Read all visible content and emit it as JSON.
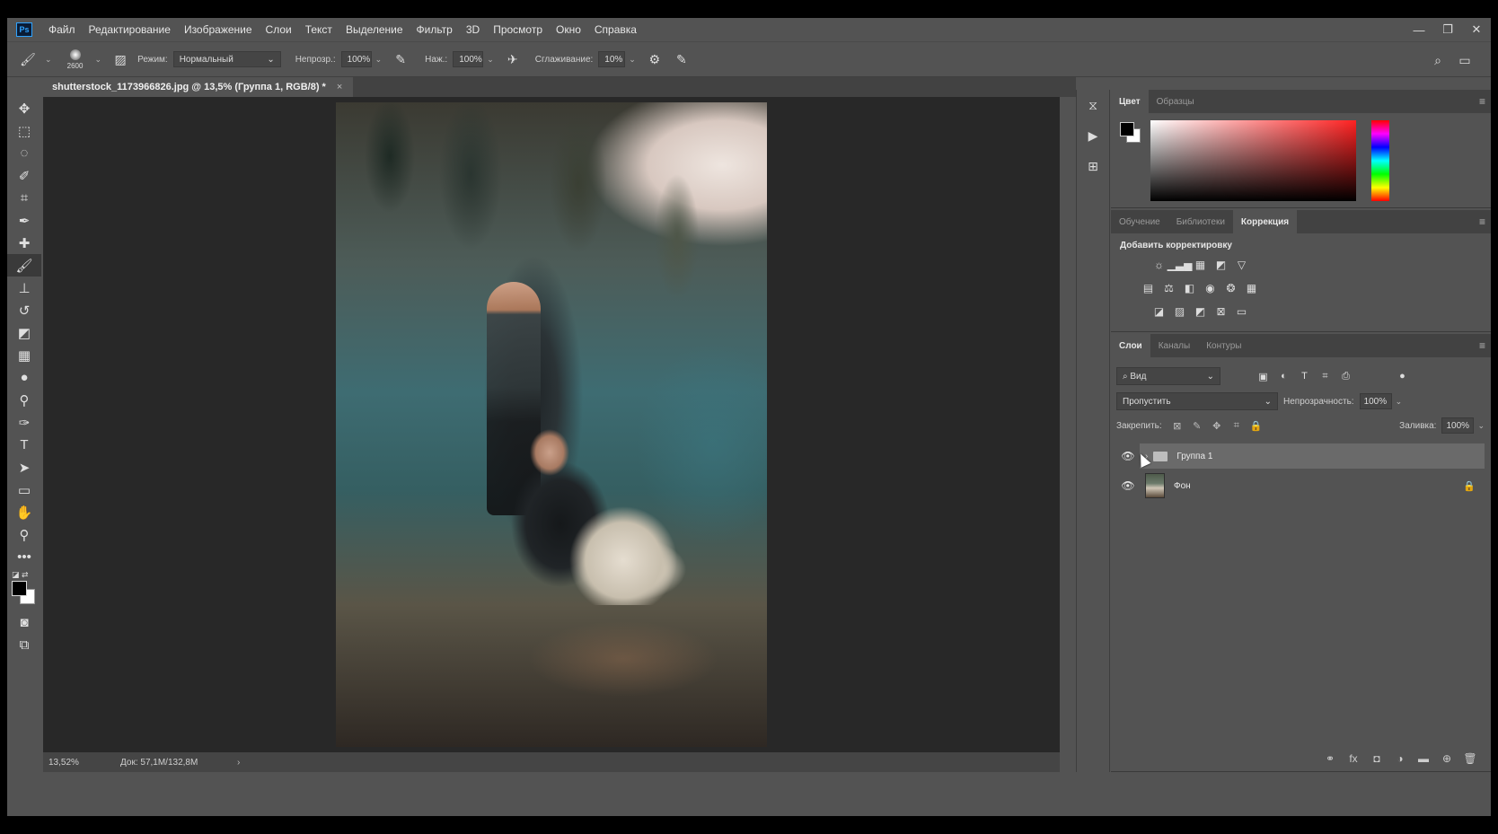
{
  "menu": [
    "Файл",
    "Редактирование",
    "Изображение",
    "Слои",
    "Текст",
    "Выделение",
    "Фильтр",
    "3D",
    "Просмотр",
    "Окно",
    "Справка"
  ],
  "app_logo": "Ps",
  "options": {
    "brush_size": "2600",
    "mode_label": "Режим:",
    "mode_value": "Нормальный",
    "opacity_label": "Непрозр.:",
    "opacity_value": "100%",
    "pressure_label": "Наж.:",
    "pressure_value": "100%",
    "smoothing_label": "Сглаживание:",
    "smoothing_value": "10%"
  },
  "document": {
    "tab_title": "shutterstock_1173966826.jpg @ 13,5% (Группа 1, RGB/8) *",
    "close": "×"
  },
  "status": {
    "zoom": "13,52%",
    "doc_size": "Док: 57,1M/132,8M",
    "arrow": "›"
  },
  "color_panel": {
    "tabs": [
      "Цвет",
      "Образцы"
    ],
    "fg_color": "#000000",
    "bg_color": "#ffffff"
  },
  "adjust_panel": {
    "tabs": [
      "Обучение",
      "Библиотеки",
      "Коррекция"
    ],
    "title": "Добавить корректировку"
  },
  "layers_panel": {
    "tabs": [
      "Слои",
      "Каналы",
      "Контуры"
    ],
    "filter_value": "Вид",
    "blend_mode": "Пропустить",
    "opacity_label": "Непрозрачность:",
    "opacity_value": "100%",
    "lock_label": "Закрепить:",
    "fill_label": "Заливка:",
    "fill_value": "100%",
    "layers": [
      {
        "name": "Группа 1",
        "type": "group",
        "visible": true
      },
      {
        "name": "Фон",
        "type": "image",
        "visible": true,
        "locked": true
      }
    ]
  }
}
